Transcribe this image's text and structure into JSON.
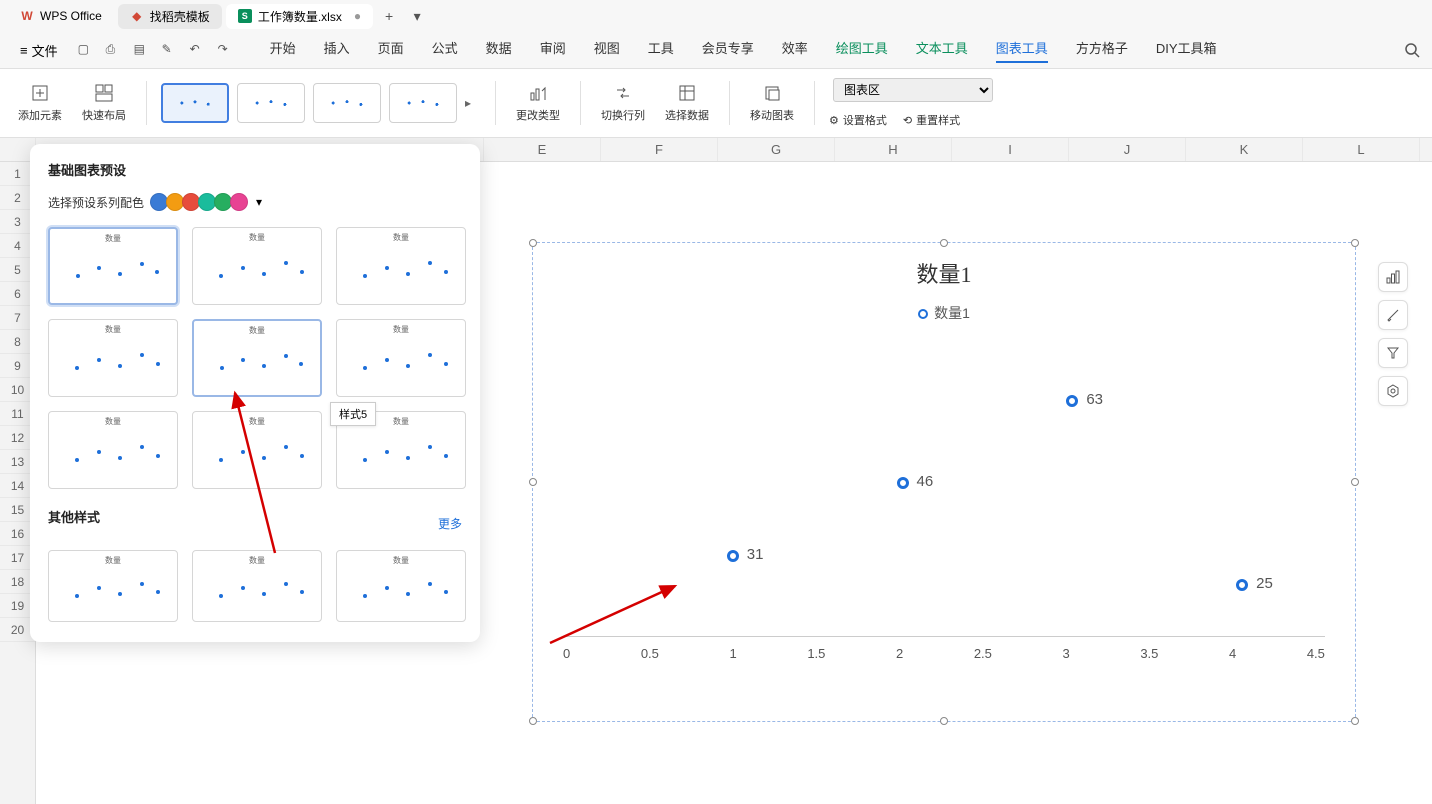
{
  "tabs": {
    "wps": "WPS Office",
    "template": "找稻壳模板",
    "active": "工作簿数量.xlsx"
  },
  "menu": {
    "file": "文件",
    "items": [
      "开始",
      "插入",
      "页面",
      "公式",
      "数据",
      "审阅",
      "视图",
      "工具",
      "会员专享",
      "效率",
      "绘图工具",
      "文本工具",
      "图表工具",
      "方方格子",
      "DIY工具箱"
    ]
  },
  "toolbar": {
    "add_element": "添加元素",
    "quick_layout": "快速布局",
    "change_type": "更改类型",
    "switch_rowcol": "切换行列",
    "select_data": "选择数据",
    "move_chart": "移动图表",
    "chart_area": "图表区",
    "set_format": "设置格式",
    "reset_style": "重置样式"
  },
  "dropdown": {
    "title": "基础图表预设",
    "color_label": "选择预设系列配色",
    "other_title": "其他样式",
    "more": "更多",
    "tooltip": "样式5",
    "thumb_title": "数量"
  },
  "palette": [
    "#3a7bd5",
    "#f39c12",
    "#e74c3c",
    "#1abc9c",
    "#27ae60",
    "#e84393"
  ],
  "sheet": {
    "cols": [
      "E",
      "F",
      "G",
      "H",
      "I",
      "J",
      "K",
      "L"
    ],
    "rows": [
      "1",
      "2",
      "3",
      "4",
      "5",
      "6",
      "7",
      "8",
      "9",
      "10",
      "11",
      "12",
      "13",
      "14",
      "15",
      "16",
      "17",
      "18",
      "19",
      "20"
    ]
  },
  "chart_data": {
    "type": "scatter",
    "title": "数量1",
    "legend": "数量1",
    "xlabel": "",
    "ylabel": "",
    "xlim": [
      0,
      4.5
    ],
    "x_ticks": [
      "0",
      "0.5",
      "1",
      "1.5",
      "2",
      "2.5",
      "3",
      "3.5",
      "4",
      "4.5"
    ],
    "series": [
      {
        "name": "数量1",
        "points": [
          {
            "x": 1,
            "y": 31,
            "label": "31"
          },
          {
            "x": 2,
            "y": 46,
            "label": "46"
          },
          {
            "x": 3,
            "y": 63,
            "label": "63"
          },
          {
            "x": 4,
            "y": 25,
            "label": "25"
          }
        ]
      }
    ]
  },
  "side": [
    "chart-elements",
    "format",
    "filter",
    "settings"
  ]
}
